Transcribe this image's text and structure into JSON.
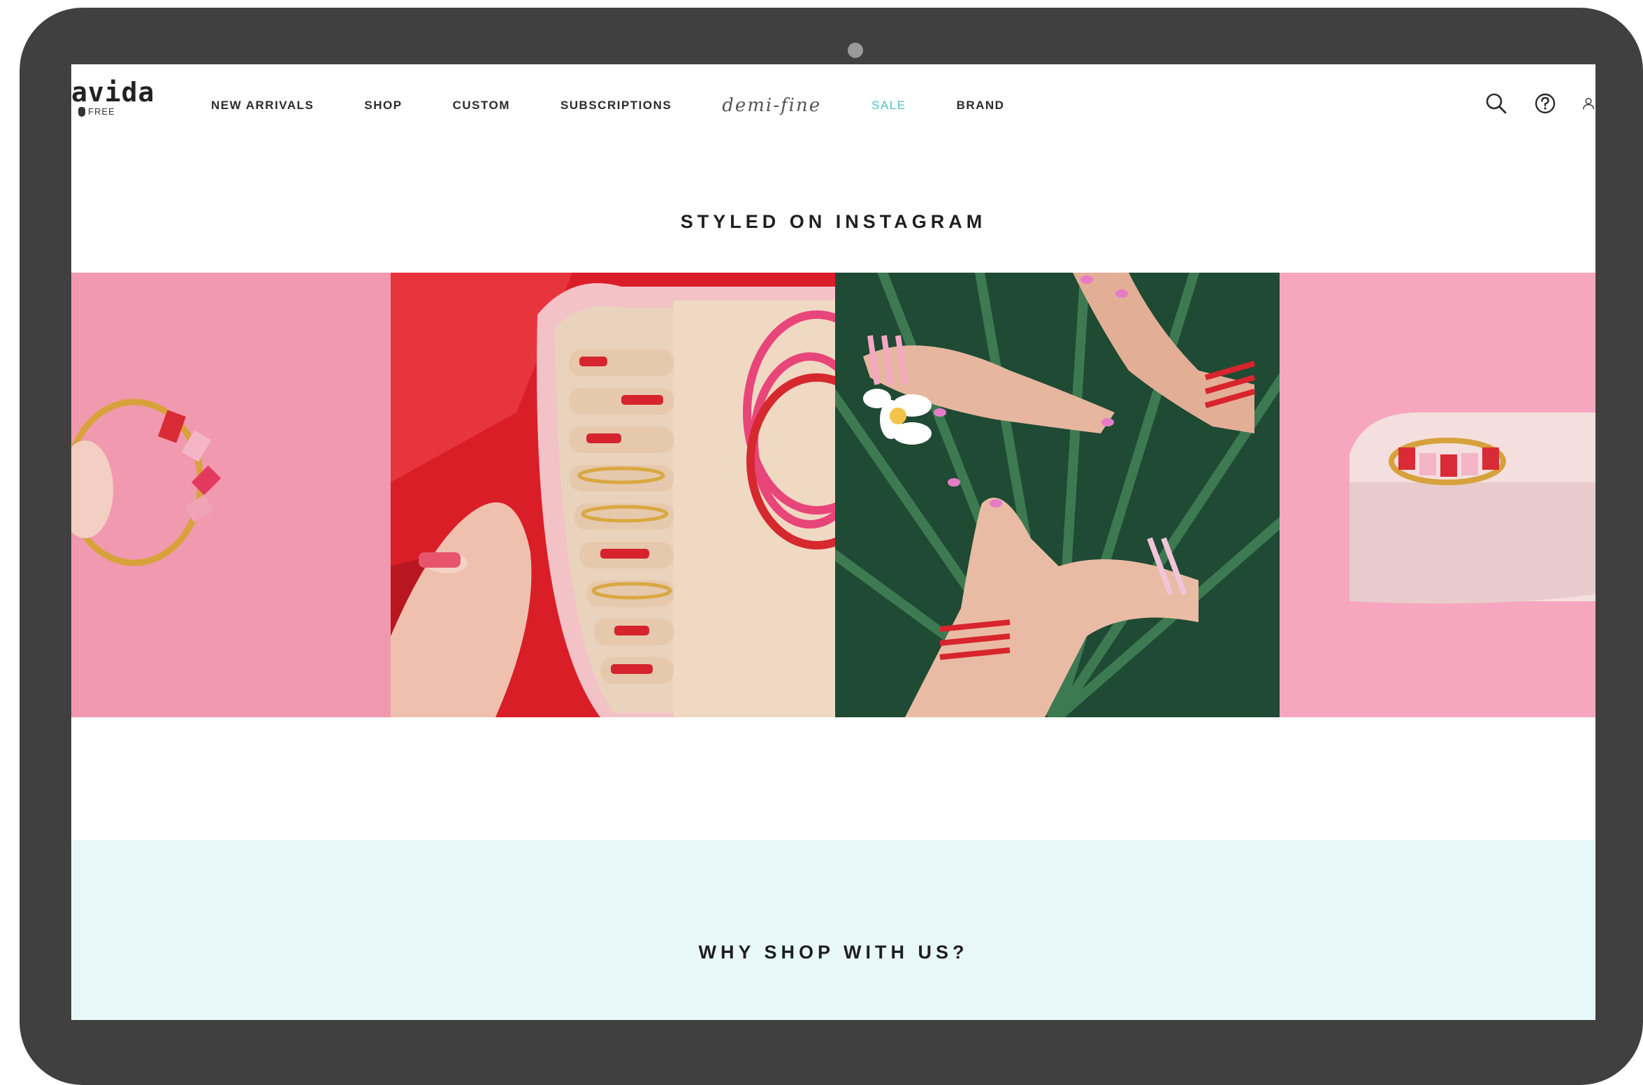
{
  "brand": {
    "logo_text": "avida",
    "logo_subtext": "FREE"
  },
  "nav": {
    "items": [
      {
        "label": "NEW ARRIVALS"
      },
      {
        "label": "SHOP"
      },
      {
        "label": "CUSTOM"
      },
      {
        "label": "SUBSCRIPTIONS"
      },
      {
        "label": "demi-fine"
      },
      {
        "label": "SALE"
      },
      {
        "label": "BRAND"
      }
    ]
  },
  "header_icons": [
    "search-icon",
    "help-icon",
    "account-icon"
  ],
  "instagram": {
    "title": "STYLED ON INSTAGRAM",
    "photos": [
      "instagram-photo-ring-pink",
      "instagram-photo-jewelry-case",
      "instagram-photo-hands-palm",
      "instagram-photo-ring-marble"
    ]
  },
  "why": {
    "title": "WHY SHOP WITH US?"
  },
  "colors": {
    "accent": "#49c3c6",
    "highlight": "#cdeff0",
    "section_bg": "#e8f8f8",
    "frame": "#404040"
  }
}
